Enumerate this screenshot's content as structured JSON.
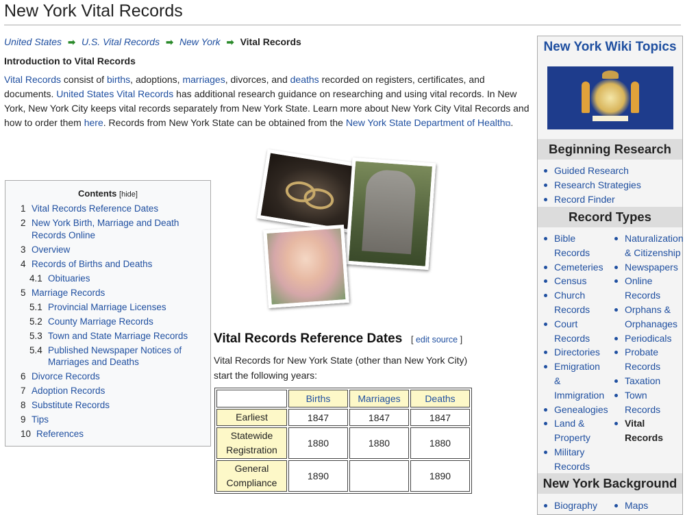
{
  "page": {
    "title": "New York Vital Records"
  },
  "breadcrumb": [
    {
      "label": "United States",
      "link": true
    },
    {
      "label": "U.S. Vital Records",
      "link": true
    },
    {
      "label": "New York",
      "link": true
    },
    {
      "label": "Vital Records",
      "link": false
    }
  ],
  "intro": {
    "heading": "Introduction to Vital Records",
    "s1_link": "Vital Records",
    "s1_a": " consist of ",
    "s1_births": "births",
    "s1_b": ", adoptions, ",
    "s1_marriages": "marriages",
    "s1_c": ", divorces, and ",
    "s1_deaths": "deaths",
    "s1_d": " recorded on registers, certificates, and documents. ",
    "s2_link": "United States Vital Records",
    "s2_text": " has additional research guidance on researching and using vital records. In New York, New York City keeps vital records separately from New York State. Learn more about New York City Vital Records and how to order them ",
    "s2_here": "here",
    "s2_after": ". Records from New York State can be obtained from the ",
    "s3_link": "New York State Department of Health",
    "s3_end": "."
  },
  "toc": {
    "title": "Contents",
    "hide": "[hide]",
    "items": [
      {
        "num": "1",
        "label": "Vital Records Reference Dates",
        "level": 1
      },
      {
        "num": "2",
        "label": "New York Birth, Marriage and Death Records Online",
        "level": 1
      },
      {
        "num": "3",
        "label": "Overview",
        "level": 1
      },
      {
        "num": "4",
        "label": "Records of Births and Deaths",
        "level": 1
      },
      {
        "num": "4.1",
        "label": "Obituaries",
        "level": 2
      },
      {
        "num": "5",
        "label": "Marriage Records",
        "level": 1
      },
      {
        "num": "5.1",
        "label": "Provincial Marriage Licenses",
        "level": 2
      },
      {
        "num": "5.2",
        "label": "County Marriage Records",
        "level": 2
      },
      {
        "num": "5.3",
        "label": "Town and State Marriage Records",
        "level": 2
      },
      {
        "num": "5.4",
        "label": "Published Newspaper Notices of Marriages and Deaths",
        "level": 2
      },
      {
        "num": "6",
        "label": "Divorce Records",
        "level": 1
      },
      {
        "num": "7",
        "label": "Adoption Records",
        "level": 1
      },
      {
        "num": "8",
        "label": "Substitute Records",
        "level": 1
      },
      {
        "num": "9",
        "label": "Tips",
        "level": 1
      },
      {
        "num": "10",
        "label": "References",
        "level": 1
      }
    ]
  },
  "section": {
    "heading": "Vital Records Reference Dates",
    "edit": "edit source",
    "text": "Vital Records for New York State (other than New York City) start the following years:"
  },
  "dates_table": {
    "columns": [
      "Births",
      "Marriages",
      "Deaths"
    ],
    "rows": [
      {
        "label": "Earliest",
        "values": [
          "1847",
          "1847",
          "1847"
        ]
      },
      {
        "label": "Statewide Registration",
        "values": [
          "1880",
          "1880",
          "1880"
        ]
      },
      {
        "label": "General Compliance",
        "values": [
          "1890",
          "",
          "1890"
        ]
      }
    ]
  },
  "sidebar": {
    "title": "New York Wiki Topics",
    "beginning_heading": "Beginning Research",
    "beginning": [
      "Guided Research",
      "Research Strategies",
      "Record Finder"
    ],
    "record_types_heading": "Record Types",
    "record_types_left": [
      "Bible Records",
      "Cemeteries",
      "Census",
      "Church Records",
      "Court Records",
      "Directories",
      "Emigration & Immigration",
      "Genealogies",
      "Land & Property",
      "Military Records"
    ],
    "record_types_right": [
      "Naturalization & Citizenship",
      "Newspapers",
      "Online Records",
      "Orphans & Orphanages",
      "Periodicals",
      "Probate Records",
      "Taxation",
      "Town Records",
      "Vital Records"
    ],
    "background_heading": "New York Background",
    "background_left": [
      "Biography"
    ],
    "background_right": [
      "Maps"
    ]
  }
}
